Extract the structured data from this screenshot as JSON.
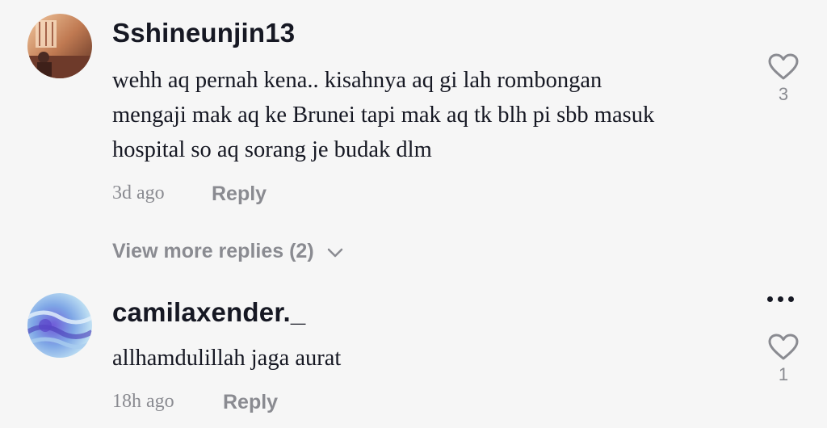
{
  "comments": [
    {
      "username": "Sshineunjin13",
      "text_lines": [
        "wehh aq pernah kena.. kisahnya aq gi lah rombongan",
        "mengaji mak aq ke Brunei tapi mak aq tk blh pi sbb masuk",
        "hospital so aq sorang je budak dlm"
      ],
      "timestamp": "3d ago",
      "reply_label": "Reply",
      "like_count": "3",
      "view_more_label": "View more replies (2)"
    },
    {
      "username": "camilaxender._",
      "text_lines": [
        "allhamdulillah jaga aurat"
      ],
      "timestamp": "18h ago",
      "reply_label": "Reply",
      "like_count": "1"
    }
  ],
  "icons": {
    "like": "heart-outline-icon",
    "expand": "chevron-down-icon",
    "more": "more-horizontal-icon"
  },
  "colors": {
    "background": "#f6f6f6",
    "primary_text": "#161823",
    "secondary_text": "#8a8b91"
  }
}
